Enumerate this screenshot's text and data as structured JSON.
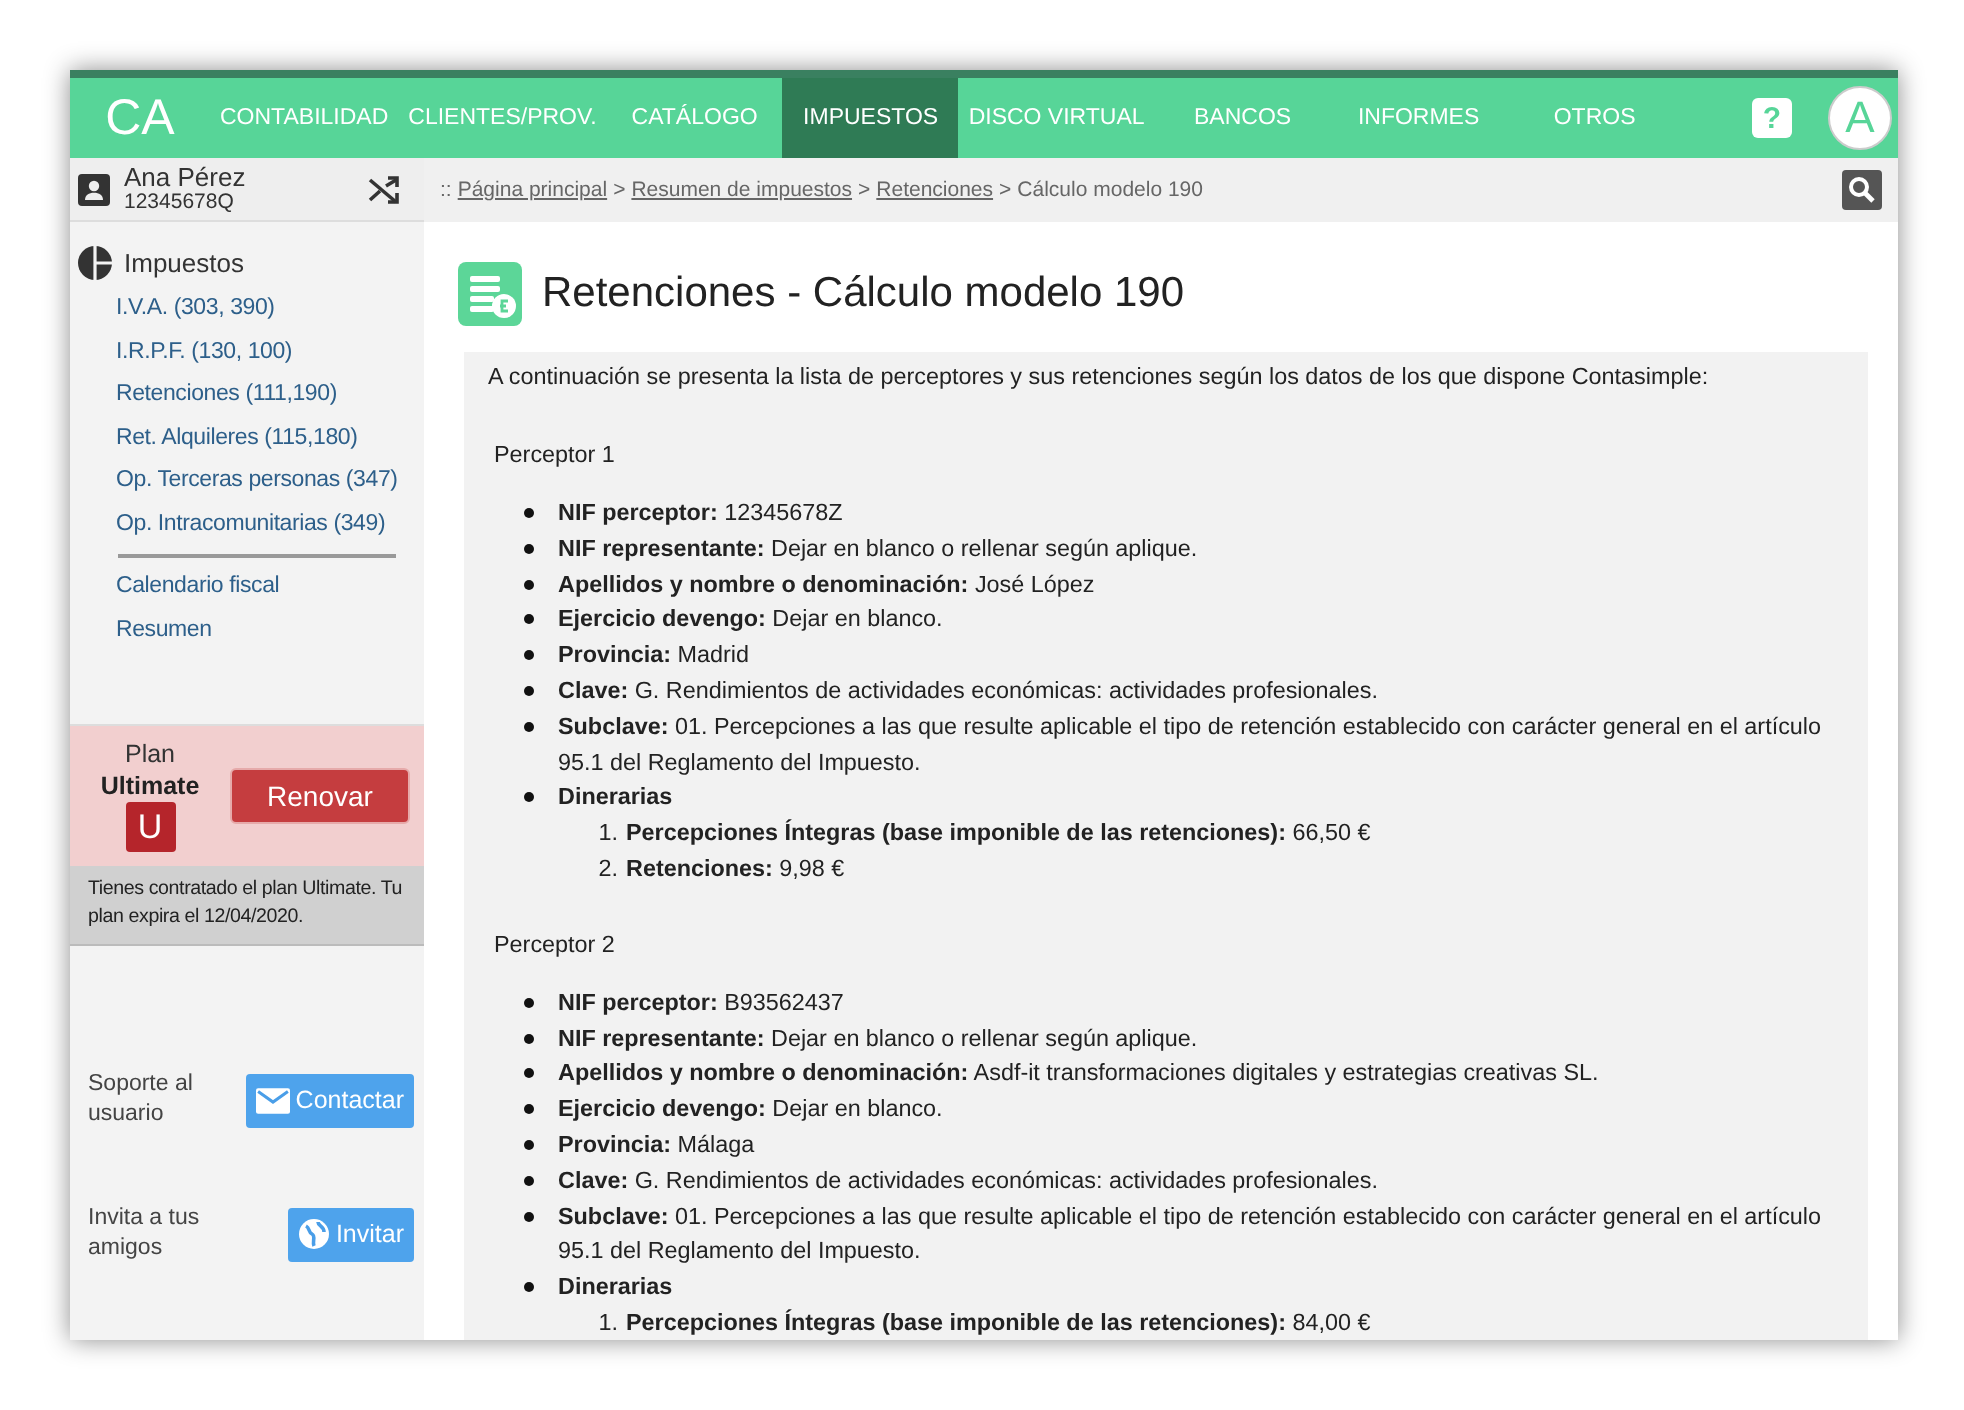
{
  "nav": {
    "logo": "CA",
    "items": [
      {
        "label": "CONTABILIDAD",
        "selected": false
      },
      {
        "label": "CLIENTES/PROV.",
        "selected": false
      },
      {
        "label": "CATÁLOGO",
        "selected": false
      },
      {
        "label": "IMPUESTOS",
        "selected": true
      },
      {
        "label": "DISCO VIRTUAL",
        "selected": false
      },
      {
        "label": "BANCOS",
        "selected": false
      },
      {
        "label": "INFORMES",
        "selected": false
      },
      {
        "label": "OTROS",
        "selected": false
      }
    ],
    "help": "?",
    "avatar": "A"
  },
  "user": {
    "name": "Ana Pérez",
    "id": "12345678Q"
  },
  "breadcrumb": {
    "prefix": "::",
    "separator": ">",
    "items": [
      {
        "label": "Página principal",
        "kind": "link"
      },
      {
        "label": "Resumen de impuestos",
        "kind": "link"
      },
      {
        "label": "Retenciones",
        "kind": "link"
      },
      {
        "label": "Cálculo modelo 190",
        "kind": "current"
      }
    ]
  },
  "sidebar": {
    "title": "Impuestos",
    "groups": [
      [
        "I.V.A. (303, 390)",
        "I.R.P.F. (130, 100)",
        "Retenciones (111,190)",
        "Ret. Alquileres (115,180)",
        "Op. Terceras personas (347)",
        "Op. Intracomunitarias (349)"
      ],
      [
        "Calendario fiscal",
        "Resumen"
      ]
    ],
    "plan": {
      "label": "Plan",
      "name": "Ultimate",
      "badge": "U",
      "button": "Renovar",
      "notice": "Tienes contratado el plan Ultimate. Tu plan expira el 12/04/2020."
    },
    "support": {
      "label": "Soporte al usuario",
      "button": "Contactar"
    },
    "invite": {
      "label": "Invita a tus amigos",
      "button": "Invitar"
    }
  },
  "page": {
    "title": "Retenciones - Cálculo modelo 190",
    "intro": "A continuación se presenta la lista de perceptores y sus retenciones según los datos de los que dispone Contasimple:",
    "perceptors": [
      {
        "title": "Perceptor 1",
        "items": [
          {
            "kind": "bullet",
            "text": "**NIF perceptor:** 12345678Z"
          },
          {
            "kind": "bullet",
            "text": "**NIF representante:** Dejar en blanco o rellenar según aplique."
          },
          {
            "kind": "bullet",
            "text": "**Apellidos y nombre o denominación:** José López"
          },
          {
            "kind": "bullet",
            "text": "**Ejercicio devengo:** Dejar en blanco."
          },
          {
            "kind": "bullet",
            "text": "**Provincia:** Madrid"
          },
          {
            "kind": "bullet",
            "text": "**Clave:** G. Rendimientos de actividades económicas: actividades profesionales."
          },
          {
            "kind": "bullet",
            "text": "**Subclave:** 01. Percepciones a las que resulte aplicable el tipo de retención establecido con carácter general en el artículo 95.1 del Reglamento del Impuesto."
          },
          {
            "kind": "group",
            "text": "**Dinerarias**",
            "children": [
              {
                "number": "1.",
                "text": "**Percepciones Íntegras (base imponible de las retenciones):** 66,50 €"
              },
              {
                "number": "2.",
                "text": "**Retenciones:** 9,98 €"
              }
            ]
          }
        ]
      },
      {
        "title": "Perceptor 2",
        "items": [
          {
            "kind": "bullet",
            "text": "**NIF perceptor:** B93562437"
          },
          {
            "kind": "bullet",
            "text": "**NIF representante:** Dejar en blanco o rellenar según aplique."
          },
          {
            "kind": "bullet",
            "text": "**Apellidos y nombre o denominación:** Asdf-it transformaciones digitales y estrategias creativas SL."
          },
          {
            "kind": "bullet",
            "text": "**Ejercicio devengo:** Dejar en blanco."
          },
          {
            "kind": "bullet",
            "text": "**Provincia:** Málaga"
          },
          {
            "kind": "bullet",
            "text": "**Clave:** G. Rendimientos de actividades económicas: actividades profesionales."
          },
          {
            "kind": "bullet",
            "text": "**Subclave:** 01. Percepciones a las que resulte aplicable el tipo de retención establecido con carácter general en el artículo 95.1 del Reglamento del Impuesto."
          },
          {
            "kind": "group",
            "text": "**Dinerarias**",
            "children": [
              {
                "number": "1.",
                "text": "**Percepciones Íntegras (base imponible de las retenciones):** 84,00 €"
              }
            ]
          }
        ]
      }
    ]
  }
}
